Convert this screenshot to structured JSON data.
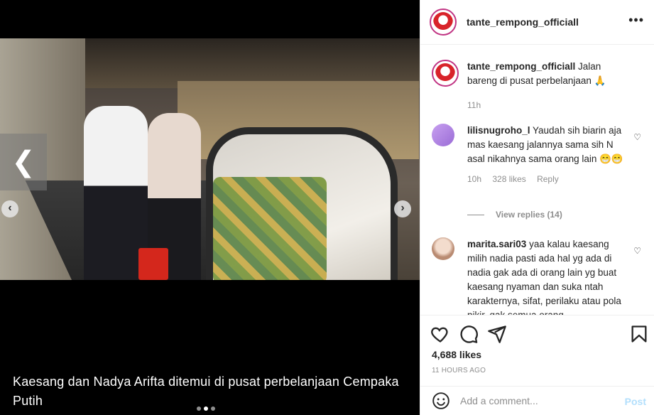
{
  "media": {
    "caption": "Kaesang dan Nadya Arifta ditemui di pusat perbelanjaan Cempaka Putih",
    "prev_glyph": "❮",
    "left_nav_glyph": "‹",
    "right_nav_glyph": "›",
    "carousel_total": 3,
    "carousel_active_index": 1
  },
  "post_header": {
    "username": "tante_rempong_officiall",
    "more_glyph": "•••"
  },
  "caption_comment": {
    "username": "tante_rempong_officiall",
    "text": "Jalan bareng di pusat perbelanjaan 🙏",
    "time": "11h"
  },
  "comments": [
    {
      "username": "lilisnugroho_l",
      "text": "Yaudah sih biarin aja mas kaesang jalannya sama sih N asal nikahnya sama orang lain 😁😁",
      "time": "10h",
      "likes": "328 likes",
      "reply": "Reply",
      "view_replies": "View replies (14)",
      "avatar_color": "#b07ee0"
    },
    {
      "username": "marita.sari03",
      "text": "yaa kalau kaesang milih nadia pasti ada hal yg ada di nadia gak ada di orang lain yg buat kaesang nyaman dan suka ntah karakternya, sifat, perilaku atau pola pikir. gak semua orang",
      "avatar_color": "#d9b9a4"
    }
  ],
  "actions": {
    "likes": "4,688 likes",
    "time": "11 HOURS AGO"
  },
  "add_comment": {
    "placeholder": "Add a comment...",
    "post_label": "Post"
  },
  "colors": {
    "accent_blue": "#0095f6",
    "post_disabled": "#b2dffc",
    "muted": "#8e8e8e"
  },
  "icons": [
    "more-icon",
    "heart-icon",
    "comment-icon",
    "share-icon",
    "bookmark-icon",
    "emoji-icon",
    "prev-arrow-icon"
  ]
}
